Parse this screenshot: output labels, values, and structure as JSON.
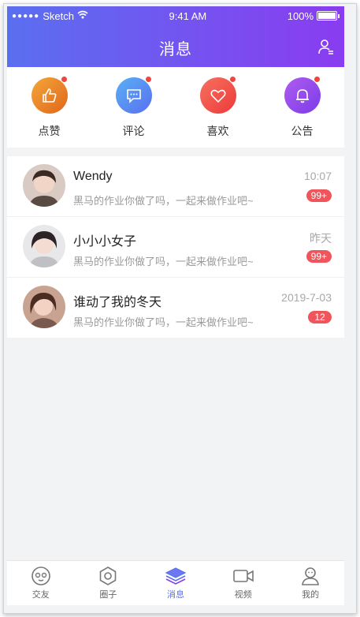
{
  "status": {
    "carrier": "Sketch",
    "time": "9:41 AM",
    "battery": "100%"
  },
  "header": {
    "title": "消息"
  },
  "quick": [
    {
      "label": "点赞",
      "icon": "thumbs-up-icon"
    },
    {
      "label": "评论",
      "icon": "comment-icon"
    },
    {
      "label": "喜欢",
      "icon": "heart-icon"
    },
    {
      "label": "公告",
      "icon": "bell-icon"
    }
  ],
  "messages": [
    {
      "name": "Wendy",
      "time": "10:07",
      "preview": "黑马的作业你做了吗，一起来做作业吧~",
      "badge": "99+"
    },
    {
      "name": "小小小女子",
      "time": "昨天",
      "preview": "黑马的作业你做了吗，一起来做作业吧~",
      "badge": "99+"
    },
    {
      "name": "谁动了我的冬天",
      "time": "2019-7-03",
      "preview": "黑马的作业你做了吗，一起来做作业吧~",
      "badge": "12"
    }
  ],
  "tabs": [
    {
      "label": "交友"
    },
    {
      "label": "圈子"
    },
    {
      "label": "消息"
    },
    {
      "label": "视频"
    },
    {
      "label": "我的"
    }
  ]
}
